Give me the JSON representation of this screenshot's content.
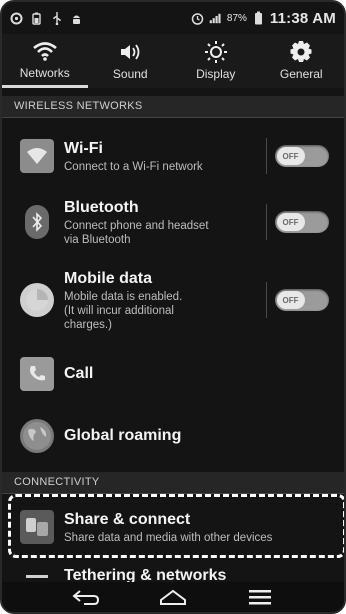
{
  "status_bar": {
    "battery_percent": "87%",
    "time": "11:38 AM",
    "left_icons": [
      "settings-status-icon",
      "battery-small-icon",
      "usb-icon",
      "android-debug-icon"
    ],
    "right_icons": [
      "alarm-icon",
      "signal-icon",
      "battery-icon"
    ]
  },
  "tabs": [
    {
      "label": "Networks",
      "icon": "wifi-icon",
      "active": true
    },
    {
      "label": "Sound",
      "icon": "speaker-icon",
      "active": false
    },
    {
      "label": "Display",
      "icon": "brightness-icon",
      "active": false
    },
    {
      "label": "General",
      "icon": "gear-icon",
      "active": false
    }
  ],
  "sections": {
    "wireless": "WIRELESS NETWORKS",
    "connectivity": "CONNECTIVITY"
  },
  "items": {
    "wifi": {
      "title": "Wi-Fi",
      "subtitle": "Connect to a Wi-Fi network",
      "toggle": "OFF"
    },
    "bluetooth": {
      "title": "Bluetooth",
      "subtitle_1": "Connect phone and headset",
      "subtitle_2": "via Bluetooth",
      "toggle": "OFF"
    },
    "mobile_data": {
      "title": "Mobile data",
      "subtitle_1": "Mobile data is enabled.",
      "subtitle_2": "(It will incur additional",
      "subtitle_3": "charges.)",
      "toggle": "OFF"
    },
    "call": {
      "title": "Call"
    },
    "global_roaming": {
      "title": "Global roaming"
    },
    "share_connect": {
      "title": "Share & connect",
      "subtitle": "Share data and media with other devices"
    },
    "tethering": {
      "title": "Tethering & networks"
    }
  },
  "colors": {
    "background": "#141414",
    "header_bg": "#262626",
    "toggle_off": "#9b9b9b"
  }
}
